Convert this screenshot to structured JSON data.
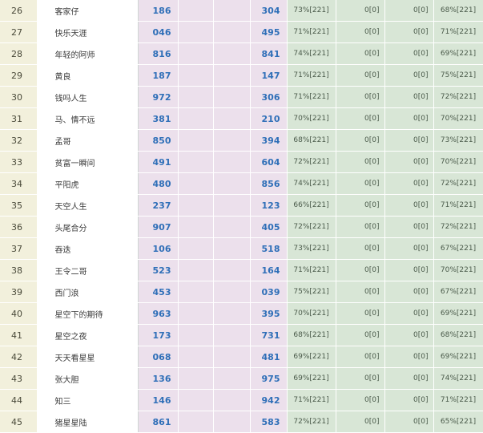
{
  "rows": [
    {
      "rank": "26",
      "name": "客家仔",
      "a": "186",
      "b": "304",
      "p1": "73%[221]",
      "z1": "0[0]",
      "z2": "0[0]",
      "p2": "68%[221]"
    },
    {
      "rank": "27",
      "name": "快乐天涯",
      "a": "046",
      "b": "495",
      "p1": "71%[221]",
      "z1": "0[0]",
      "z2": "0[0]",
      "p2": "71%[221]"
    },
    {
      "rank": "28",
      "name": "年轻的阿师",
      "a": "816",
      "b": "841",
      "p1": "74%[221]",
      "z1": "0[0]",
      "z2": "0[0]",
      "p2": "69%[221]"
    },
    {
      "rank": "29",
      "name": "黄良",
      "a": "187",
      "b": "147",
      "p1": "71%[221]",
      "z1": "0[0]",
      "z2": "0[0]",
      "p2": "75%[221]"
    },
    {
      "rank": "30",
      "name": "钱吗人生",
      "a": "972",
      "b": "306",
      "p1": "71%[221]",
      "z1": "0[0]",
      "z2": "0[0]",
      "p2": "72%[221]"
    },
    {
      "rank": "31",
      "name": "马、情不远",
      "a": "381",
      "b": "210",
      "p1": "70%[221]",
      "z1": "0[0]",
      "z2": "0[0]",
      "p2": "70%[221]"
    },
    {
      "rank": "32",
      "name": "孟哥",
      "a": "850",
      "b": "394",
      "p1": "68%[221]",
      "z1": "0[0]",
      "z2": "0[0]",
      "p2": "73%[221]"
    },
    {
      "rank": "33",
      "name": "贫富一瞬间",
      "a": "491",
      "b": "604",
      "p1": "72%[221]",
      "z1": "0[0]",
      "z2": "0[0]",
      "p2": "70%[221]"
    },
    {
      "rank": "34",
      "name": "平阳虎",
      "a": "480",
      "b": "856",
      "p1": "74%[221]",
      "z1": "0[0]",
      "z2": "0[0]",
      "p2": "72%[221]"
    },
    {
      "rank": "35",
      "name": "天空人生",
      "a": "237",
      "b": "123",
      "p1": "66%[221]",
      "z1": "0[0]",
      "z2": "0[0]",
      "p2": "71%[221]"
    },
    {
      "rank": "36",
      "name": "头尾合分",
      "a": "907",
      "b": "405",
      "p1": "72%[221]",
      "z1": "0[0]",
      "z2": "0[0]",
      "p2": "72%[221]"
    },
    {
      "rank": "37",
      "name": "吞迭",
      "a": "106",
      "b": "518",
      "p1": "73%[221]",
      "z1": "0[0]",
      "z2": "0[0]",
      "p2": "67%[221]"
    },
    {
      "rank": "38",
      "name": "王令二哥",
      "a": "523",
      "b": "164",
      "p1": "71%[221]",
      "z1": "0[0]",
      "z2": "0[0]",
      "p2": "70%[221]"
    },
    {
      "rank": "39",
      "name": "西门浪",
      "a": "453",
      "b": "039",
      "p1": "75%[221]",
      "z1": "0[0]",
      "z2": "0[0]",
      "p2": "67%[221]"
    },
    {
      "rank": "40",
      "name": "星空下的期待",
      "a": "963",
      "b": "395",
      "p1": "70%[221]",
      "z1": "0[0]",
      "z2": "0[0]",
      "p2": "69%[221]"
    },
    {
      "rank": "41",
      "name": "星空之夜",
      "a": "173",
      "b": "731",
      "p1": "68%[221]",
      "z1": "0[0]",
      "z2": "0[0]",
      "p2": "68%[221]"
    },
    {
      "rank": "42",
      "name": "天天看星星",
      "a": "068",
      "b": "481",
      "p1": "69%[221]",
      "z1": "0[0]",
      "z2": "0[0]",
      "p2": "69%[221]"
    },
    {
      "rank": "43",
      "name": "张大胆",
      "a": "136",
      "b": "975",
      "p1": "69%[221]",
      "z1": "0[0]",
      "z2": "0[0]",
      "p2": "74%[221]"
    },
    {
      "rank": "44",
      "name": "知三",
      "a": "146",
      "b": "942",
      "p1": "71%[221]",
      "z1": "0[0]",
      "z2": "0[0]",
      "p2": "71%[221]"
    },
    {
      "rank": "45",
      "name": "猪星星陆",
      "a": "861",
      "b": "583",
      "p1": "72%[221]",
      "z1": "0[0]",
      "z2": "0[0]",
      "p2": "65%[221]"
    }
  ]
}
